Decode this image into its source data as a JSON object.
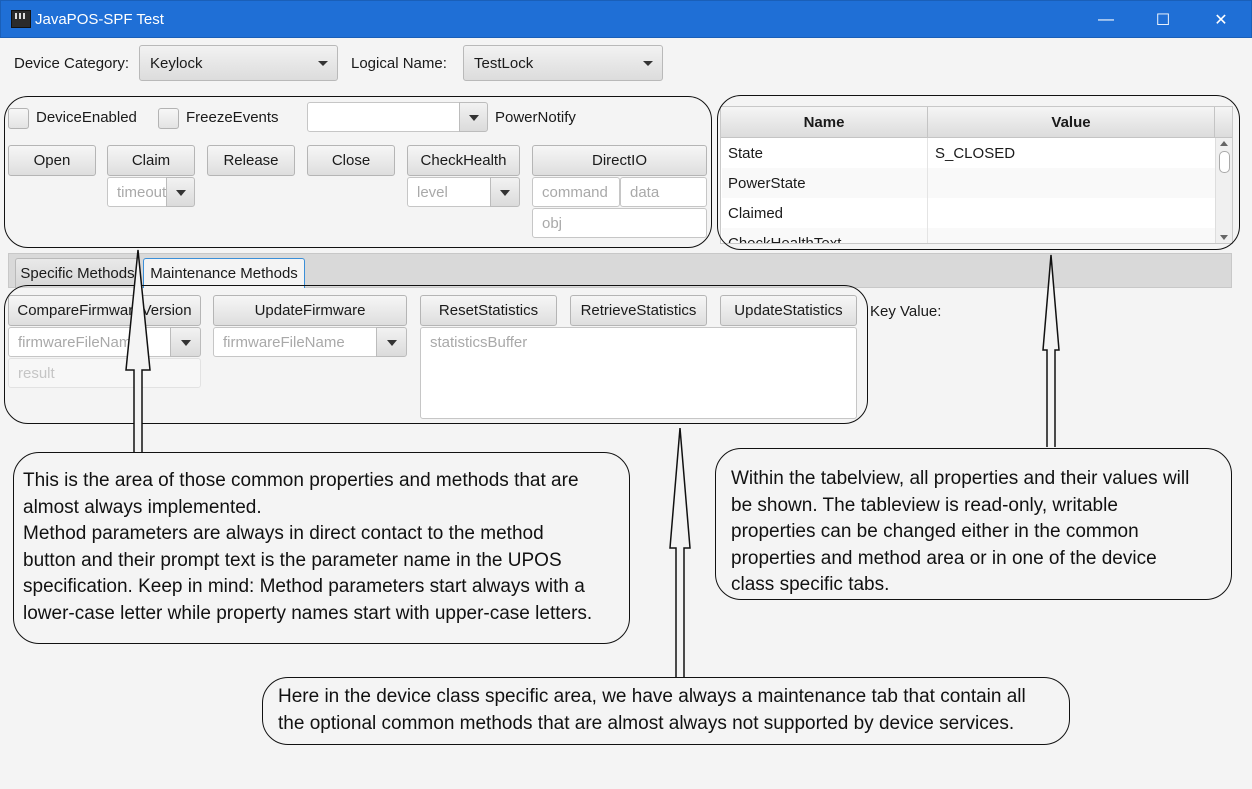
{
  "window": {
    "title": "JavaPOS-SPF Test",
    "minimize": "—",
    "maximize": "☐",
    "close": "✕"
  },
  "top": {
    "device_category_label": "Device Category:",
    "device_category_value": "Keylock",
    "logical_name_label": "Logical Name:",
    "logical_name_value": "TestLock"
  },
  "common": {
    "device_enabled": "DeviceEnabled",
    "freeze_events": "FreezeEvents",
    "power_notify_value": "",
    "power_notify_label": "PowerNotify",
    "buttons": {
      "open": "Open",
      "claim": "Claim",
      "release": "Release",
      "close": "Close",
      "check_health": "CheckHealth",
      "direct_io": "DirectIO"
    },
    "placeholders": {
      "timeout": "timeout",
      "level": "level",
      "command": "command",
      "data": "data",
      "obj": "obj"
    }
  },
  "properties_table": {
    "headers": [
      "Name",
      "Value"
    ],
    "rows": [
      {
        "name": "State",
        "value": "S_CLOSED"
      },
      {
        "name": "PowerState",
        "value": ""
      },
      {
        "name": "Claimed",
        "value": ""
      },
      {
        "name": "CheckHealthText",
        "value": ""
      }
    ]
  },
  "tabs": [
    "Specific Methods",
    "Maintenance Methods"
  ],
  "maintenance": {
    "compare_firmware": "CompareFirmwareVersion",
    "update_firmware": "UpdateFirmware",
    "reset_statistics": "ResetStatistics",
    "retrieve_statistics": "RetrieveStatistics",
    "update_statistics": "UpdateStatistics",
    "key_value_label": "Key Value:",
    "firmware_file_name_1": "firmwareFileName",
    "firmware_file_name_2": "firmwareFileName",
    "result": "result",
    "statistics_buffer": "statisticsBuffer"
  },
  "callouts": {
    "common_area": [
      "This is the area of those common properties and methods that are",
      "almost always implemented.",
      "Method parameters are always in direct contact to the method",
      "button and their prompt text is the parameter name in the UPOS",
      "specification. Keep in mind: Method parameters start always with a",
      "lower-case letter while property names start with upper-case letters."
    ],
    "tableview": [
      "Within the tabelview, all properties and their values will",
      "be shown. The tableview is read-only, writable",
      "properties can be changed either in the common",
      "properties and method area or in one of the device",
      "class specific tabs."
    ],
    "device_class": [
      "Here in the device class specific area, we have always a maintenance tab that contain all",
      "the optional common methods that are almost always not supported by device services."
    ]
  }
}
